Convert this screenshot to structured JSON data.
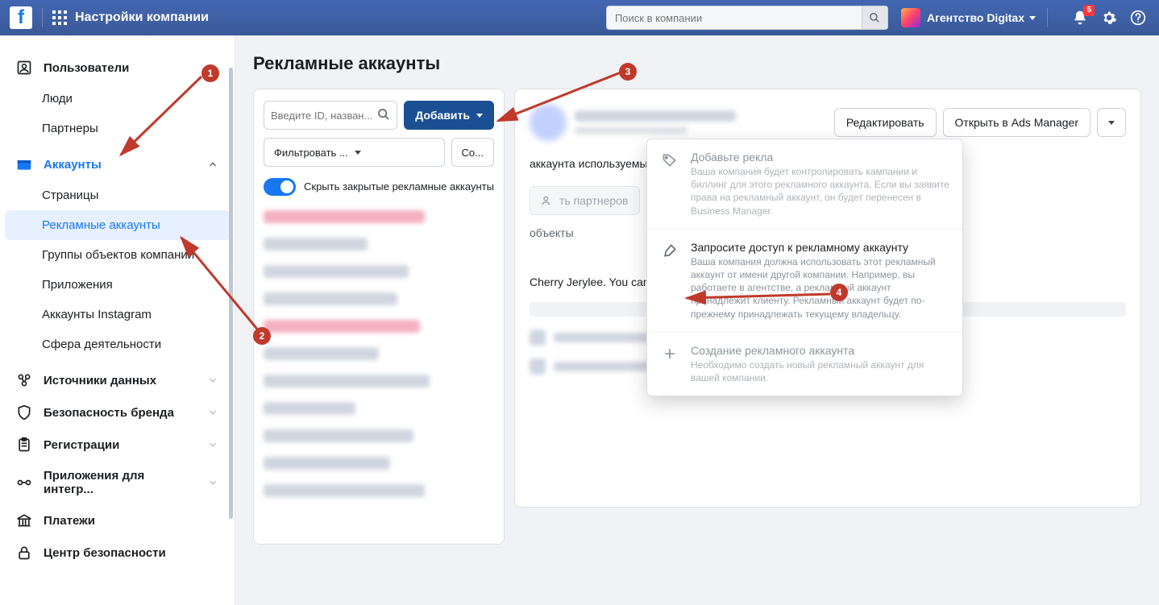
{
  "topbar": {
    "title": "Настройки компании",
    "search_placeholder": "Поиск в компании",
    "agency_name": "Агентство Digitax",
    "notification_count": "5"
  },
  "sidebar": {
    "users_label": "Пользователи",
    "users_children": {
      "people": "Люди",
      "partners": "Партнеры"
    },
    "accounts_label": "Аккаунты",
    "accounts_children": {
      "pages": "Страницы",
      "ad_accounts": "Рекламные аккаунты",
      "asset_groups": "Группы объектов компании",
      "apps": "Приложения",
      "instagram": "Аккаунты Instagram",
      "lob": "Сфера деятельности"
    },
    "data_sources": "Источники данных",
    "brand_safety": "Безопасность бренда",
    "registrations": "Регистрации",
    "integrations": "Приложения для интегр...",
    "payments": "Платежи",
    "security_center": "Центр безопасности"
  },
  "main": {
    "page_title": "Рекламные аккаунты",
    "search_placeholder": "Введите ID, назван...",
    "add_button": "Добавить",
    "filter_button": "Фильтровать ...",
    "sort_button": "Со...",
    "toggle_label": "Скрыть закрытые рекламные аккаунты"
  },
  "right": {
    "edit_button": "Редактировать",
    "open_ads_manager": "Открыть в Ads Manager",
    "notice": "аккаунта используемыми способами оплаты невозможно.",
    "add_partners_btn": "ть партнеров",
    "add_assets_btn": "Добавить объекты",
    "section_label": "объекты",
    "permission_text": "Cherry Jerylee. You can view, edit or delete their permissions."
  },
  "dropdown": {
    "item1": {
      "title": "Добавьте рекла",
      "desc": "Ваша компания будет контролировать кампании и биллинг для этого рекламного аккаунта. Если вы заявите права на рекламный аккаунт, он будет перенесен в Business Manager."
    },
    "item2": {
      "title": "Запросите доступ к рекламному аккаунту",
      "desc": "Ваша компания должна использовать этот рекламный аккаунт от имени другой компании. Например, вы работаете в агентстве, а рекламный аккаунт принадлежит клиенту. Рекламный аккаунт будет по-прежнему принадлежать текущему владельцу."
    },
    "item3": {
      "title": "Создание рекламного аккаунта",
      "desc": "Необходимо создать новый рекламный аккаунт для вашей компании."
    }
  },
  "steps": {
    "s1": "1",
    "s2": "2",
    "s3": "3",
    "s4": "4"
  }
}
